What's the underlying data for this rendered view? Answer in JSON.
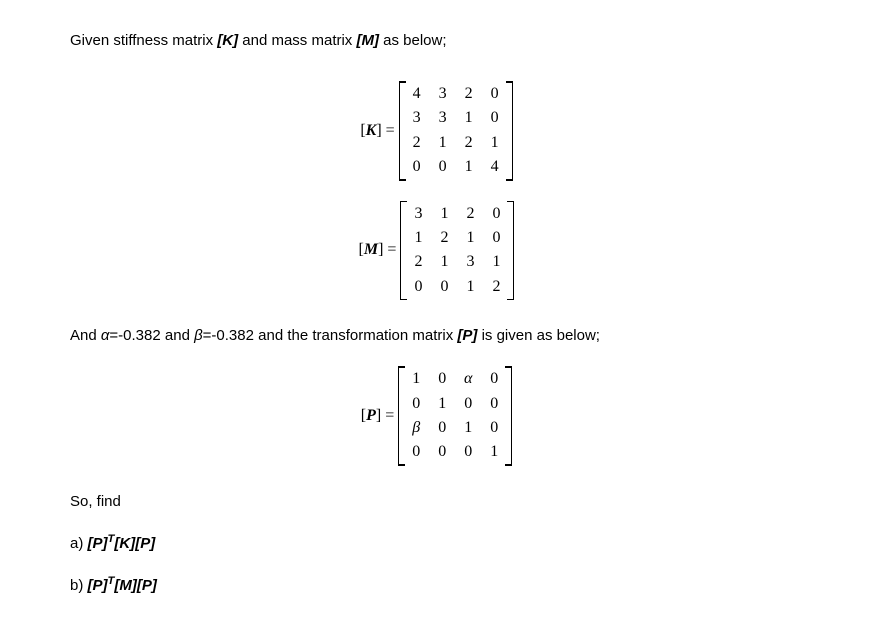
{
  "intro": {
    "prefix": "Given stiffness matrix ",
    "k_label": "[K]",
    "mid": " and mass matrix ",
    "m_label": "[M]",
    "suffix": " as below;"
  },
  "matrices": {
    "K": {
      "label_var": "K",
      "rows": [
        [
          "4",
          "3",
          "2",
          "0"
        ],
        [
          "3",
          "3",
          "1",
          "0"
        ],
        [
          "2",
          "1",
          "2",
          "1"
        ],
        [
          "0",
          "0",
          "1",
          "4"
        ]
      ]
    },
    "M": {
      "label_var": "M",
      "rows": [
        [
          "3",
          "1",
          "2",
          "0"
        ],
        [
          "1",
          "2",
          "1",
          "0"
        ],
        [
          "2",
          "1",
          "3",
          "1"
        ],
        [
          "0",
          "0",
          "1",
          "2"
        ]
      ]
    },
    "P": {
      "label_var": "P",
      "rows": [
        [
          "1",
          "0",
          "α",
          "0"
        ],
        [
          "0",
          "1",
          "0",
          "0"
        ],
        [
          "β",
          "0",
          "1",
          "0"
        ],
        [
          "0",
          "0",
          "0",
          "1"
        ]
      ]
    }
  },
  "params": {
    "prefix": "And ",
    "alpha_name": "α",
    "alpha_val": "=-0.382",
    "and1": " and ",
    "beta_name": "β",
    "beta_val": "=-0.382",
    "and2": " and the transformation matrix ",
    "p_label": "[P]",
    "suffix": " is given as below;"
  },
  "so_find": "So, find",
  "questions": {
    "a": {
      "prefix": "a) ",
      "expr_open": "[P]",
      "sup": "T",
      "rest": "[K][P]"
    },
    "b": {
      "prefix": "b) ",
      "expr_open": "[P]",
      "sup": "T",
      "rest": "[M][P]"
    }
  },
  "chart_data": {
    "type": "table",
    "matrices": {
      "K": [
        [
          4,
          3,
          2,
          0
        ],
        [
          3,
          3,
          1,
          0
        ],
        [
          2,
          1,
          2,
          1
        ],
        [
          0,
          0,
          1,
          4
        ]
      ],
      "M": [
        [
          3,
          1,
          2,
          0
        ],
        [
          1,
          2,
          1,
          0
        ],
        [
          2,
          1,
          3,
          1
        ],
        [
          0,
          0,
          1,
          2
        ]
      ],
      "P": [
        [
          "1",
          "0",
          "α",
          "0"
        ],
        [
          "0",
          "1",
          "0",
          "0"
        ],
        [
          "β",
          "0",
          "1",
          "0"
        ],
        [
          "0",
          "0",
          "0",
          "1"
        ]
      ]
    },
    "parameters": {
      "alpha": -0.382,
      "beta": -0.382
    },
    "tasks": [
      "[P]^T [K] [P]",
      "[P]^T [M] [P]"
    ]
  }
}
